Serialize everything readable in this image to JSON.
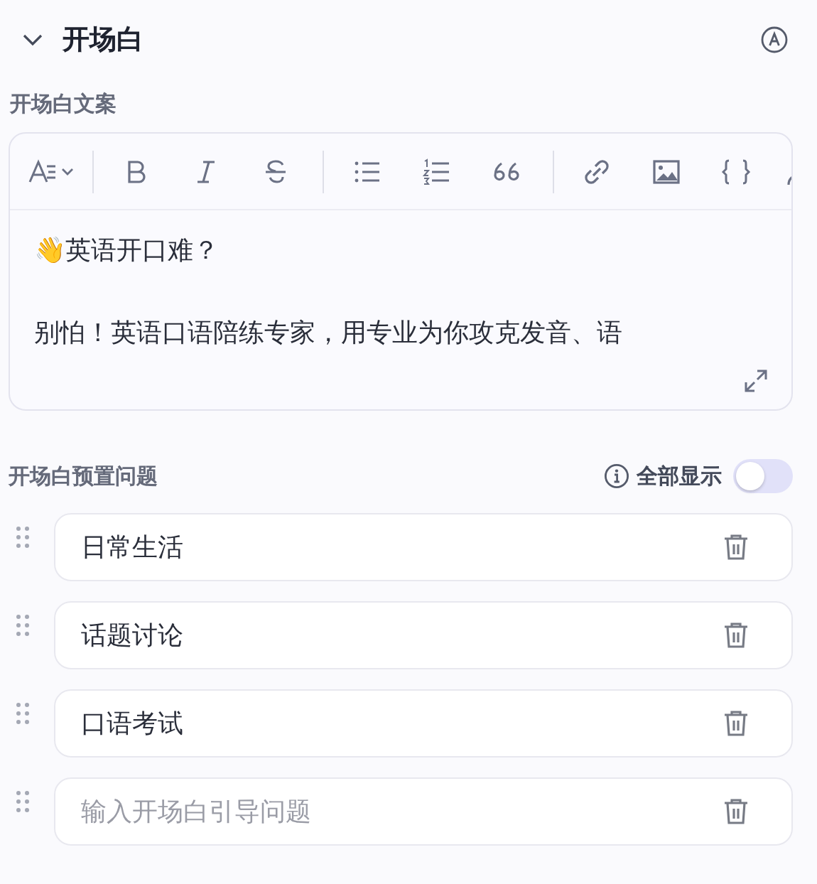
{
  "section": {
    "title": "开场白",
    "expanded": true
  },
  "copy": {
    "label": "开场白文案",
    "paragraphs": [
      "👋英语开口难？",
      "别怕！英语口语陪练专家，用专业为你攻克发音、语"
    ]
  },
  "preset": {
    "label": "开场白预置问题",
    "show_all_label": "全部显示",
    "show_all_on": false,
    "questions": [
      {
        "value": "日常生活"
      },
      {
        "value": "话题讨论"
      },
      {
        "value": "口语考试"
      },
      {
        "placeholder": "输入开场白引导问题"
      }
    ]
  }
}
